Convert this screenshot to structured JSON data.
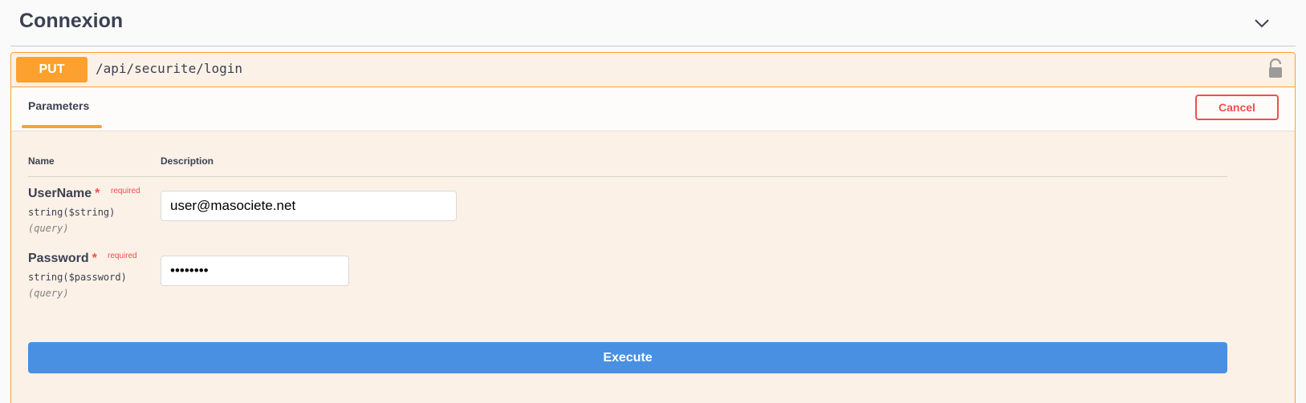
{
  "section": {
    "title": "Connexion",
    "collapse_icon": "chevron-down-icon"
  },
  "operation": {
    "method": "PUT",
    "path": "/api/securite/login",
    "lock_icon": "lock-open-icon",
    "method_color": "#fca130"
  },
  "tabs": {
    "parameters_label": "Parameters",
    "cancel_label": "Cancel"
  },
  "table": {
    "col_name": "Name",
    "col_description": "Description"
  },
  "params": [
    {
      "name": "UserName",
      "required_star": "*",
      "required_text": "required",
      "type": "string($string)",
      "in": "(query)",
      "value": "user@masociete.net"
    },
    {
      "name": "Password",
      "required_star": "*",
      "required_text": "required",
      "type": "string($password)",
      "in": "(query)",
      "value": "••••••••"
    }
  ],
  "execute_label": "Execute",
  "colors": {
    "execute": "#4990e2",
    "cancel": "#f04e4e",
    "background": "#fbf1e7"
  }
}
